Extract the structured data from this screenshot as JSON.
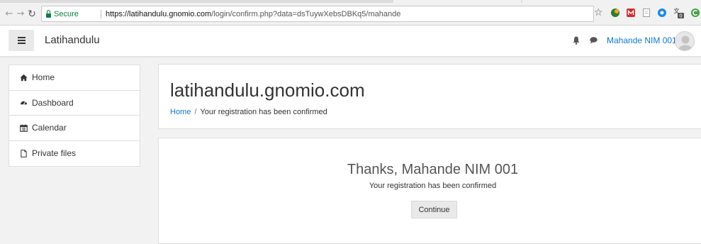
{
  "browser": {
    "secure_label": "Secure",
    "url_host": "https://latihandulu.gnomio.com",
    "url_path": "/login/confirm.php?data=dsTuywXebsDBKq5/mahande",
    "nav": {
      "back_icon": "back-arrow-icon",
      "forward_icon": "forward-arrow-icon",
      "reload_icon": "reload-icon"
    },
    "extensions": [
      "green-leaf-icon",
      "red-m-icon",
      "page-icon",
      "blue-circle-icon",
      "translate-badge-icon",
      "green-c-icon"
    ],
    "extension_badge": "0"
  },
  "navbar": {
    "brand": "Latihandulu",
    "username": "Mahande NIM 001",
    "icons": [
      "menu-icon",
      "bell-icon",
      "chat-icon",
      "avatar"
    ]
  },
  "sidebar": {
    "items": [
      {
        "label": "Home",
        "icon": "home-icon"
      },
      {
        "label": "Dashboard",
        "icon": "dashboard-icon"
      },
      {
        "label": "Calendar",
        "icon": "calendar-icon"
      },
      {
        "label": "Private files",
        "icon": "file-icon"
      }
    ]
  },
  "header": {
    "title": "latihandulu.gnomio.com",
    "breadcrumb": {
      "home": "Home",
      "separator": "/",
      "current": "Your registration has been confirmed"
    }
  },
  "main": {
    "heading": "Thanks, Mahande NIM 001",
    "message": "Your registration has been confirmed",
    "continue_label": "Continue"
  },
  "colors": {
    "link": "#1177d1",
    "secure": "#0b8043",
    "page_bg": "#f2f2f2"
  }
}
